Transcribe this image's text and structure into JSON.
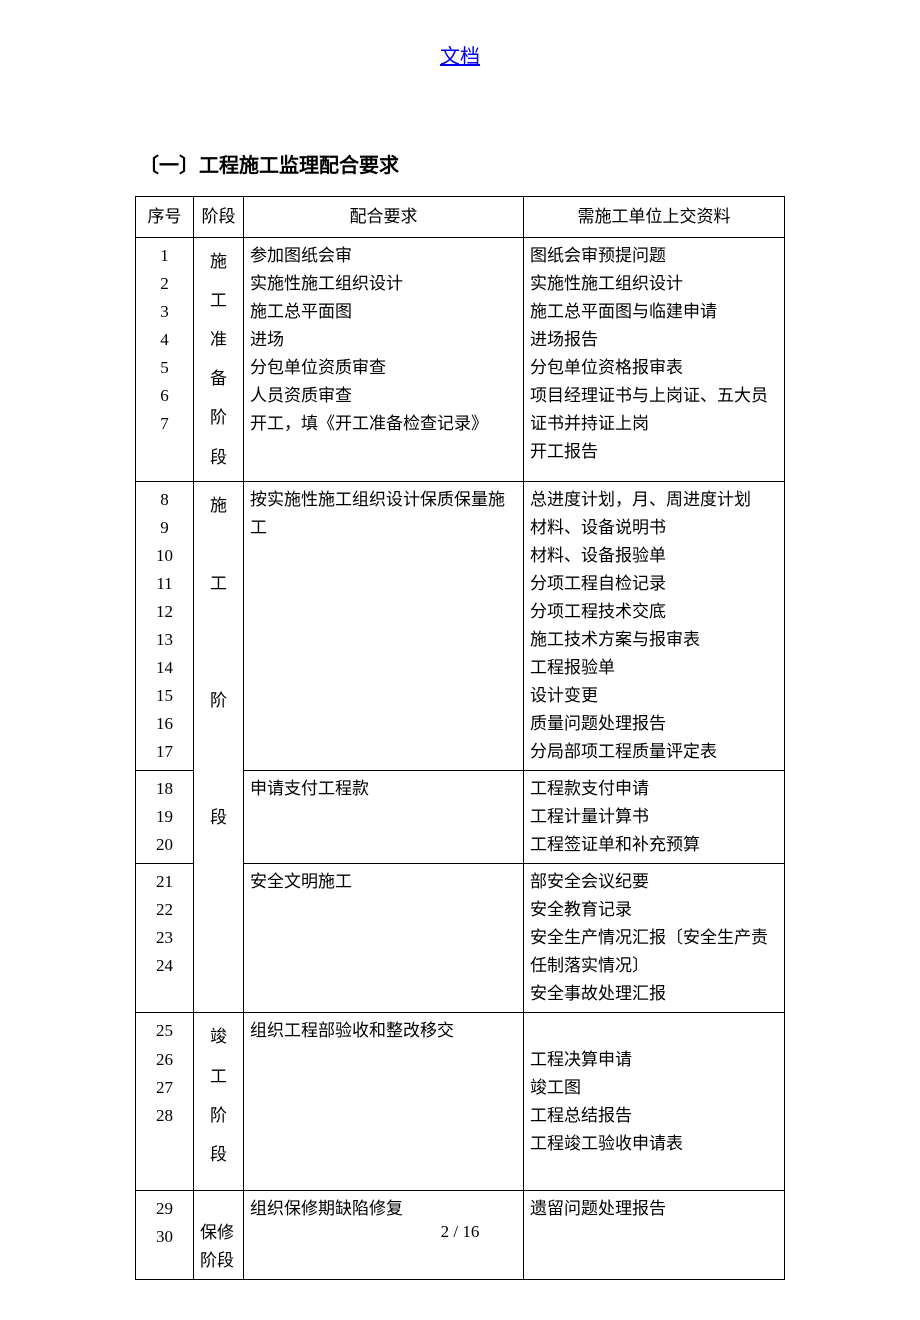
{
  "header": {
    "link_text": "文档"
  },
  "section_title": "〔一〕工程施工监理配合要求",
  "table": {
    "headers": [
      "序号",
      "阶段",
      "配合要求",
      "需施工单位上交资料"
    ],
    "rows": [
      {
        "seq": [
          "1",
          "2",
          "3",
          "4",
          "5",
          "6",
          "7"
        ],
        "stage_lines": [
          "施",
          "工",
          "准",
          "备",
          "阶",
          "段"
        ],
        "req": "参加图纸会审\n实施性施工组织设计\n施工总平面图\n进场\n分包单位资质审查\n人员资质审查\n开工，填《开工准备检查记录》",
        "mat": "图纸会审预提问题\n实施性施工组织设计\n施工总平面图与临建申请\n进场报告\n分包单位资格报审表\n项目经理证书与上岗证、五大员证书并持证上岗\n开工报告"
      },
      {
        "seq": [
          "8",
          "9",
          "10",
          "11",
          "12",
          "13",
          "14",
          "15",
          "16",
          "17"
        ],
        "stage_lines": [
          "施",
          "",
          "工",
          "",
          "",
          "阶",
          "",
          "",
          "段"
        ],
        "stage_rowspan": 3,
        "req": "按实施性施工组织设计保质保量施工",
        "mat": "总进度计划，月、周进度计划\n材料、设备说明书\n材料、设备报验单\n分项工程自检记录\n分项工程技术交底\n施工技术方案与报审表\n工程报验单\n设计变更\n质量问题处理报告\n分局部项工程质量评定表"
      },
      {
        "seq": [
          "18",
          "19",
          "20"
        ],
        "req": "申请支付工程款",
        "mat": "工程款支付申请\n工程计量计算书\n工程签证单和补充预算"
      },
      {
        "seq": [
          "21",
          "22",
          "23",
          "24"
        ],
        "req": "安全文明施工",
        "mat": "部安全会议纪要\n安全教育记录\n安全生产情况汇报〔安全生产责任制落实情况〕\n安全事故处理汇报"
      },
      {
        "seq": [
          "25",
          "26",
          "27",
          "28"
        ],
        "stage_lines": [
          "竣",
          "工",
          "阶",
          "段"
        ],
        "req": "组织工程部验收和整改移交",
        "mat": "\n工程决算申请\n竣工图\n工程总结报告\n工程竣工验收申请表\n"
      },
      {
        "seq": [
          "29",
          "30"
        ],
        "stage_text": "保修阶段",
        "req": "组织保修期缺陷修复",
        "mat": "遗留问题处理报告"
      }
    ]
  },
  "footer": {
    "page_label": "2 / 16"
  }
}
